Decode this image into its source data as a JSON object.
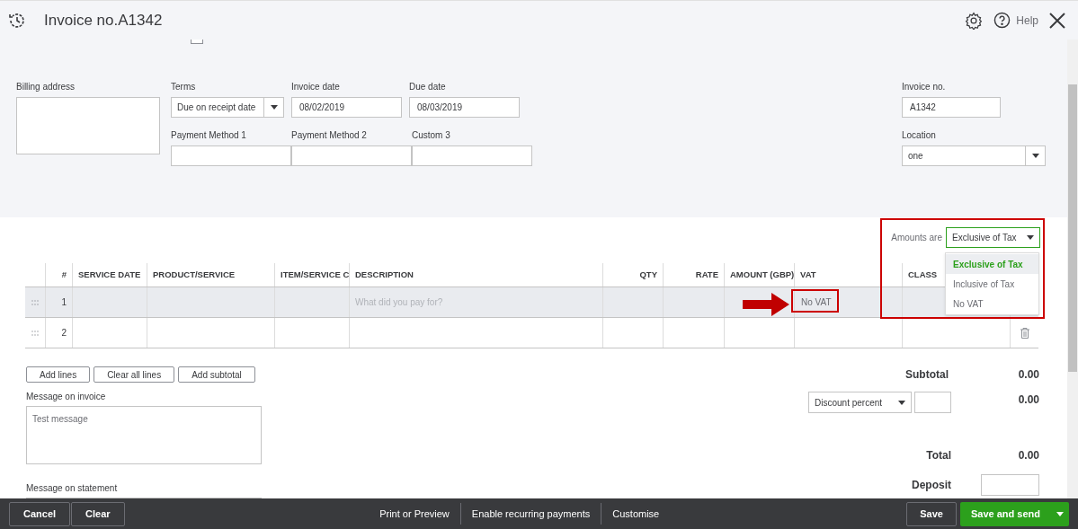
{
  "header": {
    "title": "Invoice no.A1342",
    "help": "Help"
  },
  "form": {
    "top_checkbox": {
      "checked": false
    },
    "billing_address": {
      "label": "Billing address"
    },
    "row1": [
      {
        "label": "Terms",
        "value": "Due on receipt date",
        "kind": "select"
      },
      {
        "label": "Invoice date",
        "value": "08/02/2019",
        "kind": "input"
      },
      {
        "label": "Due date",
        "value": "08/03/2019",
        "kind": "input"
      }
    ],
    "row2": [
      {
        "label": "Payment Method 1",
        "kind": "input"
      },
      {
        "label": "Payment Method 2",
        "kind": "input"
      },
      {
        "label": "Custom 3",
        "kind": "input"
      }
    ],
    "invoice_no": {
      "label": "Invoice no.",
      "value": "A1342"
    },
    "location": {
      "label": "Location",
      "value": "one"
    }
  },
  "amounts": {
    "label": "Amounts are",
    "value": "Exclusive of Tax",
    "options": [
      {
        "label": "Exclusive of Tax",
        "selected": true
      },
      {
        "label": "Inclusive of Tax",
        "selected": false
      },
      {
        "label": "No VAT",
        "selected": false
      }
    ]
  },
  "table": {
    "columns": [
      "#",
      "SERVICE DATE",
      "PRODUCT/SERVICE",
      "ITEM/SERVICE C",
      "DESCRIPTION",
      "QTY",
      "RATE",
      "AMOUNT (GBP)",
      "VAT",
      "CLASS"
    ],
    "rows": [
      {
        "number": "1",
        "description_placeholder": "What did you pay for?",
        "vat": "No VAT",
        "selected": true,
        "show_delete": false
      },
      {
        "number": "2",
        "selected": false,
        "show_delete": true
      }
    ]
  },
  "line_buttons": [
    "Add lines",
    "Clear all lines",
    "Add subtotal"
  ],
  "message_on_invoice": {
    "label": "Message on invoice",
    "value": "Test message"
  },
  "message_on_statement": {
    "label": "Message on statement"
  },
  "totals": {
    "subtotal_label": "Subtotal",
    "subtotal": "0.00",
    "discount_type": "Discount percent",
    "discount": "0.00",
    "total_label": "Total",
    "total": "0.00",
    "deposit_label": "Deposit"
  },
  "footer": {
    "left": [
      "Cancel",
      "Clear"
    ],
    "center": [
      "Print or Preview",
      "Enable recurring payments",
      "Customise"
    ],
    "save": "Save",
    "save_and_send": "Save and send"
  }
}
